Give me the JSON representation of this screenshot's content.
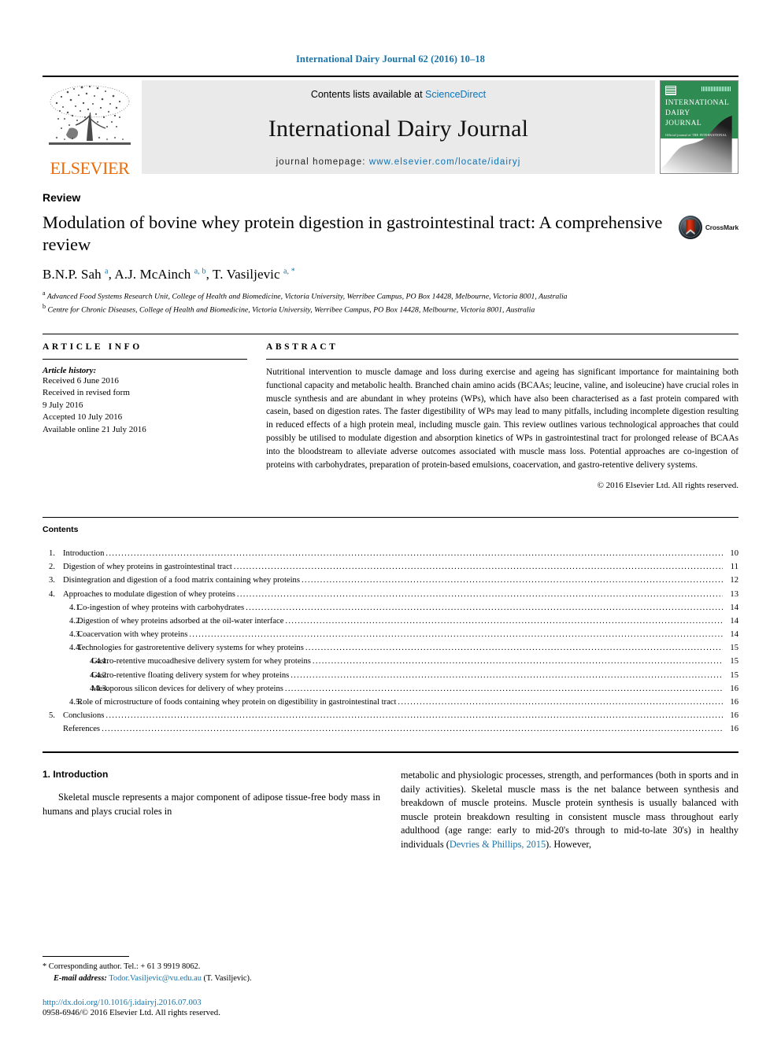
{
  "running_head": "International Dairy Journal 62 (2016) 10–18",
  "masthead": {
    "contents_prefix": "Contents lists available at ",
    "sciencedirect": "ScienceDirect",
    "journal_title": "International Dairy Journal",
    "homepage_prefix": "journal homepage: ",
    "homepage_url": "www.elsevier.com/locate/idairyj",
    "publisher": "ELSEVIER",
    "cover_title_line1": "INTERNATIONAL",
    "cover_title_line2": "DAIRY",
    "cover_title_line3": "JOURNAL",
    "cover_subtitle": "Official journal of\nTHE INTERNATIONAL DAIRY FEDERATION",
    "accent_blue": "#0a73b8",
    "elsevier_orange": "#eb6b0a",
    "cover_green": "#2e8b52"
  },
  "article": {
    "type": "Review",
    "title": "Modulation of bovine whey protein digestion in gastrointestinal tract: A comprehensive review",
    "crossmark_label": "CrossMark",
    "authors_html": "B.N.P. Sah <sup>a</sup>, A.J. McAinch <sup>a, b</sup>, T. Vasiljevic <sup>a, *</sup>",
    "affiliation_a": "Advanced Food Systems Research Unit, College of Health and Biomedicine, Victoria University, Werribee Campus, PO Box 14428, Melbourne, Victoria 8001, Australia",
    "affiliation_b": "Centre for Chronic Diseases, College of Health and Biomedicine, Victoria University, Werribee Campus, PO Box 14428, Melbourne, Victoria 8001, Australia"
  },
  "article_info": {
    "heading": "ARTICLE INFO",
    "history_label": "Article history:",
    "lines": [
      "Received 6 June 2016",
      "Received in revised form",
      "9 July 2016",
      "Accepted 10 July 2016",
      "Available online 21 July 2016"
    ]
  },
  "abstract": {
    "heading": "ABSTRACT",
    "text": "Nutritional intervention to muscle damage and loss during exercise and ageing has significant importance for maintaining both functional capacity and metabolic health. Branched chain amino acids (BCAAs; leucine, valine, and isoleucine) have crucial roles in muscle synthesis and are abundant in whey proteins (WPs), which have also been characterised as a fast protein compared with casein, based on digestion rates. The faster digestibility of WPs may lead to many pitfalls, including incomplete digestion resulting in reduced effects of a high protein meal, including muscle gain. This review outlines various technological approaches that could possibly be utilised to modulate digestion and absorption kinetics of WPs in gastrointestinal tract for prolonged release of BCAAs into the bloodstream to alleviate adverse outcomes associated with muscle mass loss. Potential approaches are co-ingestion of proteins with carbohydrates, preparation of protein-based emulsions, coacervation, and gastro-retentive delivery systems.",
    "copyright": "© 2016 Elsevier Ltd. All rights reserved."
  },
  "contents": {
    "heading": "Contents",
    "items": [
      {
        "level": 1,
        "num": "1.",
        "label": "Introduction",
        "page": "10"
      },
      {
        "level": 1,
        "num": "2.",
        "label": "Digestion of whey proteins in gastrointestinal tract",
        "page": "11"
      },
      {
        "level": 1,
        "num": "3.",
        "label": "Disintegration and digestion of a food matrix containing whey proteins",
        "page": "12"
      },
      {
        "level": 1,
        "num": "4.",
        "label": "Approaches to modulate digestion of whey proteins",
        "page": "13"
      },
      {
        "level": 2,
        "num": "4.1.",
        "label": "Co-ingestion of whey proteins with carbohydrates",
        "page": "14"
      },
      {
        "level": 2,
        "num": "4.2.",
        "label": "Digestion of whey proteins adsorbed at the oil-water interface",
        "page": "14"
      },
      {
        "level": 2,
        "num": "4.3.",
        "label": "Coacervation with whey proteins",
        "page": "14"
      },
      {
        "level": 2,
        "num": "4.4.",
        "label": "Technologies for gastroretentive delivery systems for whey proteins",
        "page": "15"
      },
      {
        "level": 3,
        "num": "4.4.1.",
        "label": "Gastro-retentive mucoadhesive delivery system for whey proteins",
        "page": "15"
      },
      {
        "level": 3,
        "num": "4.4.2.",
        "label": "Gastro-retentive floating delivery system for whey proteins",
        "page": "15"
      },
      {
        "level": 3,
        "num": "4.4.3.",
        "label": "Mesoporous silicon devices for delivery of whey proteins",
        "page": "16"
      },
      {
        "level": 2,
        "num": "4.5.",
        "label": "Role of microstructure of foods containing whey protein on digestibility in gastrointestinal tract",
        "page": "16"
      },
      {
        "level": 1,
        "num": "5.",
        "label": "Conclusions",
        "page": "16"
      },
      {
        "level": 1,
        "num": "",
        "label": "References",
        "page": "16"
      }
    ]
  },
  "body": {
    "section_heading": "1. Introduction",
    "left_paragraph": "Skeletal muscle represents a major component of adipose tissue-free body mass in humans and plays crucial roles in",
    "right_paragraph_pre": "metabolic and physiologic processes, strength, and performances (both in sports and in daily activities). Skeletal muscle mass is the net balance between synthesis and breakdown of muscle proteins. Muscle protein synthesis is usually balanced with muscle protein breakdown resulting in consistent muscle mass throughout early adulthood (age range: early to mid-20's through to mid-to-late 30's) in healthy individuals (",
    "right_citation": "Devries & Phillips, 2015",
    "right_paragraph_post": "). However,"
  },
  "footnote": {
    "corresponding": "* Corresponding author. Tel.: + 61 3 9919 8062.",
    "email_label": "E-mail address:",
    "email": "Todor.Vasiljevic@vu.edu.au",
    "email_suffix": " (T. Vasiljevic).",
    "doi": "http://dx.doi.org/10.1016/j.idairyj.2016.07.003",
    "issn": "0958-6946/© 2016 Elsevier Ltd. All rights reserved."
  }
}
